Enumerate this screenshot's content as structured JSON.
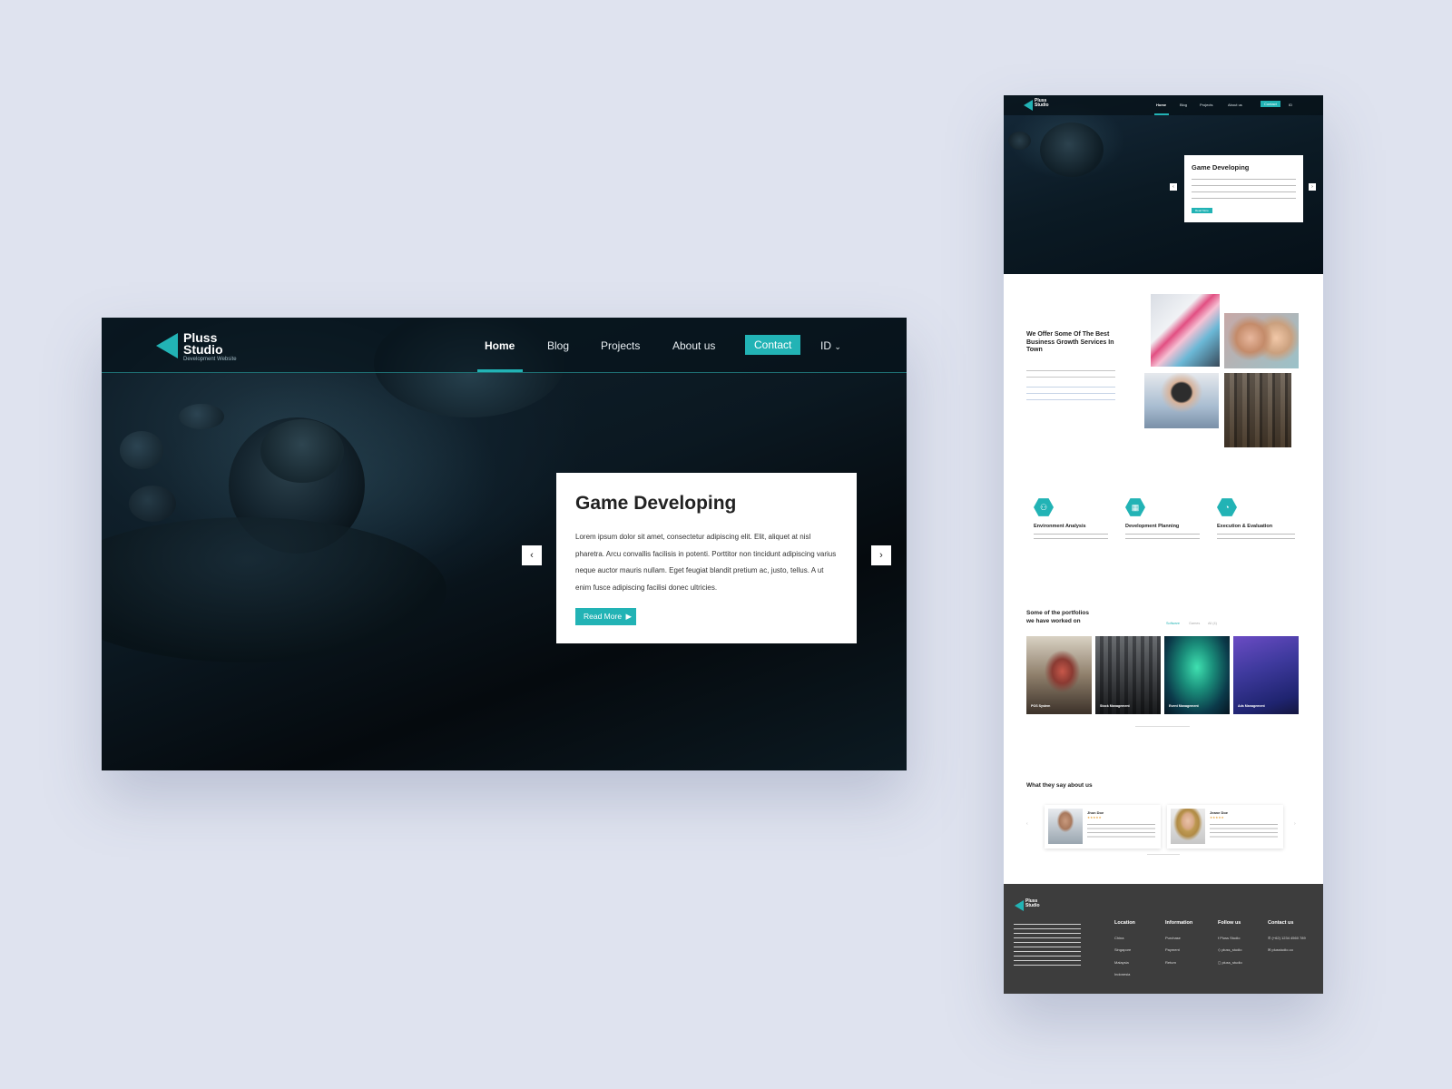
{
  "brand": {
    "name_line1": "Pluss",
    "name_line2": "Studio",
    "tagline": "Development Website",
    "accent": "#22b3b5",
    "dark": "#0b1821",
    "footer_bg": "#3d3d3d"
  },
  "nav": {
    "items": [
      {
        "label": "Home"
      },
      {
        "label": "Blog"
      },
      {
        "label": "Projects"
      },
      {
        "label": "About us"
      }
    ],
    "contact_label": "Contact",
    "lang_label": "ID",
    "lang_icon": "chevron-down-icon"
  },
  "hero": {
    "title": "Game Developing",
    "body": "Lorem ipsum dolor sit amet, consectetur adipiscing elit. Elit, aliquet at nisl pharetra. Arcu convallis facilisis in potenti. Porttitor non tincidunt adipiscing varius neque auctor mauris nullam. Eget feugiat blandit pretium ac, justo, tellus. A ut enim fusce adipiscing facilisi donec ultricies.",
    "cta": "Read More",
    "prev_icon": "chevron-left-icon",
    "next_icon": "chevron-right-icon",
    "prev_glyph": "‹",
    "next_glyph": "›"
  },
  "services": {
    "title": "We Offer Some Of The Best Business Growth Services In Town",
    "items": [
      {
        "title": "Environment Analysis",
        "icon": "binoculars-icon",
        "glyph": "⚇"
      },
      {
        "title": "Development Planning",
        "icon": "calendar-icon",
        "glyph": "▦"
      },
      {
        "title": "Execution & Evaluation",
        "icon": "pie-chart-icon",
        "glyph": "◔"
      }
    ]
  },
  "portfolio": {
    "title_line1": "Some of the portfolios",
    "title_line2": "we have worked on",
    "tabs": [
      "Software",
      "Games",
      "All (4)"
    ],
    "items": [
      {
        "title": "POS System"
      },
      {
        "title": "Stock Management"
      },
      {
        "title": "Event Management"
      },
      {
        "title": "Ads Management"
      }
    ]
  },
  "testimonials": {
    "title": "What they say about us",
    "items": [
      {
        "name": "Jhon Doe",
        "stars": "★★★★★"
      },
      {
        "name": "Jeane Doe",
        "stars": "★★★★★"
      }
    ]
  },
  "footer": {
    "columns": [
      {
        "title": "Location",
        "items": [
          "China",
          "Singapore",
          "Malaysia",
          "Indonesia"
        ]
      },
      {
        "title": "Information",
        "items": [
          "Purchase",
          "Payment",
          "Return"
        ]
      },
      {
        "title": "Follow us",
        "items": [
          "Pluss Studio",
          "pluss_studio",
          "pluss_studio"
        ]
      },
      {
        "title": "Contact us",
        "items": [
          "(+62) 1234 4560 789",
          "plusstudio.co"
        ]
      }
    ]
  }
}
